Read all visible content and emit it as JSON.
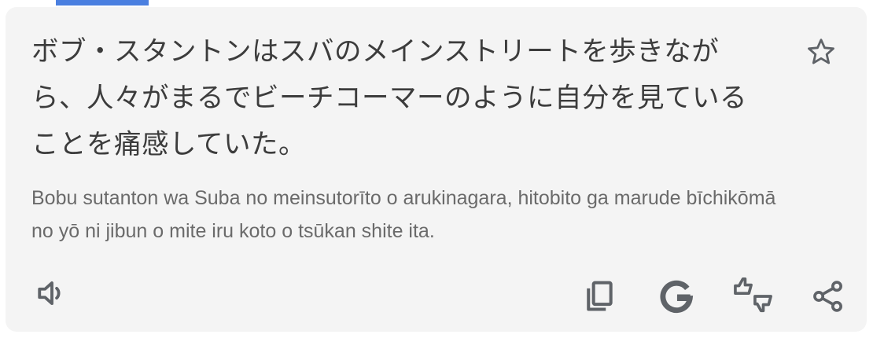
{
  "card": {
    "translation_text": "ボブ・スタントンはスバのメインストリートを歩きながら、人々がまるでビーチコーマーのように自分を見ていることを痛感していた。",
    "romanization_text": "Bobu sutanton wa Suba no meinsutorīto o arukinagara, hitobito ga marude bīchikōmā no yō ni jibun o mite iru koto o tsūkan shite ita."
  },
  "icons": {
    "save": "star-outline-icon",
    "listen": "volume-icon",
    "copy": "copy-icon",
    "search": "google-g-icon",
    "feedback": "thumbs-up-down-icon",
    "share": "share-icon"
  },
  "colors": {
    "card_background": "#f4f4f4",
    "primary_text": "#3c3c3c",
    "secondary_text": "#6a6a6a",
    "icon": "#5f6368",
    "accent": "#4a7fe0"
  }
}
